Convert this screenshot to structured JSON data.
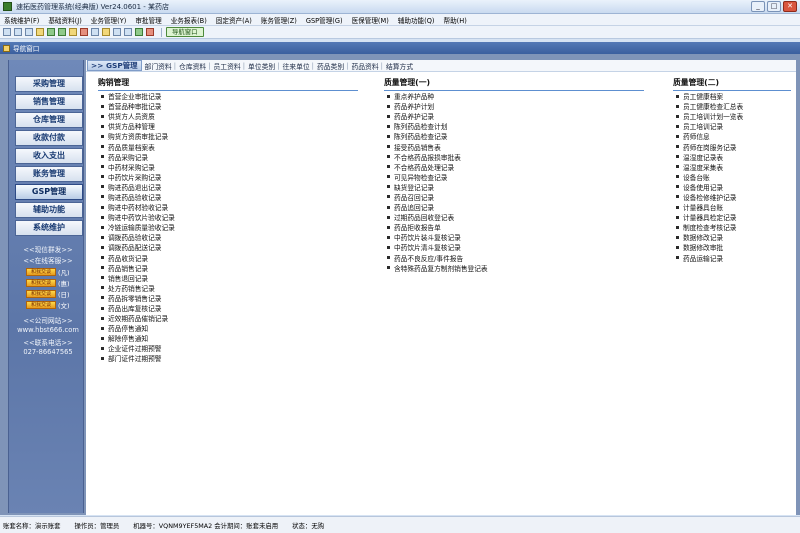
{
  "window": {
    "title": "速拓医药管理系统(经典版) Ver24.0601 - 某药店",
    "minimize": "_",
    "maximize": "□",
    "close": "✕"
  },
  "menubar": [
    "系统维护(F)",
    "基础资料(J)",
    "业务管理(Y)",
    "审批管理",
    "业务报表(B)",
    "固定资产(A)",
    "账务管理(Z)",
    "GSP管理(G)",
    "医保管理(M)",
    "辅助功能(Q)",
    "帮助(H)"
  ],
  "toolbar": {
    "nav_button": "导航窗口"
  },
  "mdi": {
    "title": "导航窗口"
  },
  "sidebar": {
    "buttons": [
      "采购管理",
      "销售管理",
      "仓库管理",
      "收款付款",
      "收入支出",
      "账务管理",
      "GSP管理",
      "辅助功能",
      "系统维护"
    ],
    "active": "GSP管理",
    "suggest": "<<现信群发>>",
    "online_service": "<<在线客服>>",
    "qq_button_text": "和我交谈",
    "qq": [
      "(凡)",
      "(惠)",
      "(日)",
      "(文)"
    ],
    "website_label": "<<公司网站>>",
    "website": "www.hbst666.com",
    "phone_label": "<<联系电话>>",
    "phone": "027-86647565"
  },
  "tabs": {
    "active": ">> GSP管理",
    "items": [
      "部门资料",
      "仓库资料",
      "员工资料",
      "单位类别",
      "往来单位",
      "药品类别",
      "药品资料",
      "结算方式"
    ],
    "separator": "|"
  },
  "columns": [
    {
      "title": "购销管理",
      "items": [
        "首营企业审批记录",
        "首营品种审批记录",
        "供货方人员资质",
        "供货方品种管理",
        "购货方资质审批记录",
        "药品质量档案表",
        "药品采购记录",
        "中药材采购记录",
        "中药饮片采购记录",
        "购进药品退出记录",
        "购进药品验收记录",
        "购进中药材验收记录",
        "购进中药饮片验收记录",
        "冷链运输质量验收记录",
        "调拨药品验收记录",
        "调拨药品配送记录",
        "药品收货记录",
        "药品销售记录",
        "销售退回记录",
        "处方药销售记录",
        "药品拆零销售记录",
        "药品出库复核记录",
        "近效期药品催销记录",
        "药品停售通知",
        "解除停售通知",
        "企业证件过期预警",
        "部门证件过期预警"
      ]
    },
    {
      "title": "质量管理(一)",
      "items": [
        "重点养护品种",
        "药品养护计划",
        "药品养护记录",
        "陈列药品检查计划",
        "陈列药品检查记录",
        "接受药品销售表",
        "不合格药品报损审批表",
        "不合格药品处理记录",
        "可见异物检查记录",
        "缺货登记记录",
        "药品召回记录",
        "药品追回记录",
        "过期药品回收登记表",
        "药品拒收报告单",
        "中药饮片装斗复核记录",
        "中药饮片清斗复核记录",
        "药品不良反应/事件报告",
        "含特殊药品复方制剂销售登记表"
      ]
    },
    {
      "title": "质量管理(二)",
      "items": [
        "员工健康档案",
        "员工健康检查汇总表",
        "员工培训计划一览表",
        "员工培训记录",
        "药师信息",
        "药师在岗服务记录",
        "温湿度记录表",
        "温湿度采集表",
        "设备台账",
        "设备使用记录",
        "设备检修维护记录",
        "计量器具台账",
        "计量器具检定记录",
        "制度检查考核记录",
        "数据修改记录",
        "数据修改审批",
        "药品运输记录"
      ]
    }
  ],
  "statusbar": {
    "account": "账套名称：演示账套",
    "operator": "操作员：管理员",
    "machine": "机器号：VQNM9YEF5MA2 会计期间：账套未启用",
    "state": "状态：无购"
  }
}
